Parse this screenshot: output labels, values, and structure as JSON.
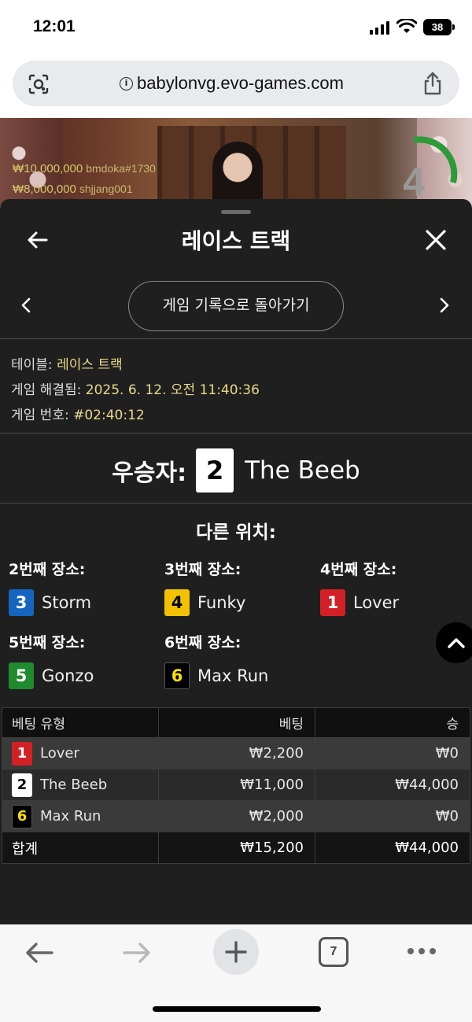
{
  "status_bar": {
    "time": "12:01",
    "battery": "38"
  },
  "browser": {
    "url": "babylonvg.evo-games.com",
    "info_glyph": "i",
    "open_tabs": "7"
  },
  "video_overlay": {
    "feed": [
      {
        "amount": "₩10,000,000",
        "user": "bmdoka#1730"
      },
      {
        "amount": "₩8,000,000",
        "user": "shjjang001"
      }
    ],
    "countdown": "4"
  },
  "panel": {
    "title": "레이스 트랙",
    "history_button": "게임 기록으로 돌아가기",
    "info": {
      "table_label": "테이블:",
      "table_value": "레이스 트랙",
      "resolved_label": "게임 해결됨:",
      "resolved_value": "2025. 6. 12. 오전 11:40:36",
      "number_label": "게임 번호:",
      "number_value": "#02:40:12"
    },
    "winner": {
      "label": "우승자:",
      "number": "2",
      "name": "The Beeb",
      "color": "#ffffff"
    },
    "other_title": "다른 위치:",
    "places": [
      {
        "label": "2번째 장소:",
        "number": "3",
        "name": "Storm",
        "color": "#1565c0",
        "text_color": "#ffffff"
      },
      {
        "label": "3번째 장소:",
        "number": "4",
        "name": "Funky",
        "color": "#f2c200",
        "text_color": "#000000"
      },
      {
        "label": "4번째 장소:",
        "number": "1",
        "name": "Lover",
        "color": "#d32027",
        "text_color": "#ffffff"
      },
      {
        "label": "5번째 장소:",
        "number": "5",
        "name": "Gonzo",
        "color": "#1f8a2e",
        "text_color": "#ffffff"
      },
      {
        "label": "6번째 장소:",
        "number": "6",
        "name": "Max Run",
        "color": "#000000",
        "text_color": "#f5e000"
      }
    ],
    "table": {
      "headers": [
        "베팅 유형",
        "베팅",
        "승"
      ],
      "rows": [
        {
          "number": "1",
          "name": "Lover",
          "bet": "₩2,200",
          "win": "₩0",
          "color": "#d32027",
          "text_color": "#ffffff"
        },
        {
          "number": "2",
          "name": "The Beeb",
          "bet": "₩11,000",
          "win": "₩44,000",
          "color": "#ffffff",
          "text_color": "#000000"
        },
        {
          "number": "6",
          "name": "Max Run",
          "bet": "₩2,000",
          "win": "₩0",
          "color": "#000000",
          "text_color": "#f5e000"
        }
      ],
      "total": {
        "label": "합계",
        "bet": "₩15,200",
        "win": "₩44,000"
      }
    }
  },
  "icons": {
    "back": "arrow-left-icon",
    "close": "close-icon",
    "prev": "chevron-left-icon",
    "next": "chevron-right-icon",
    "scroll_top": "chevron-up-icon"
  }
}
